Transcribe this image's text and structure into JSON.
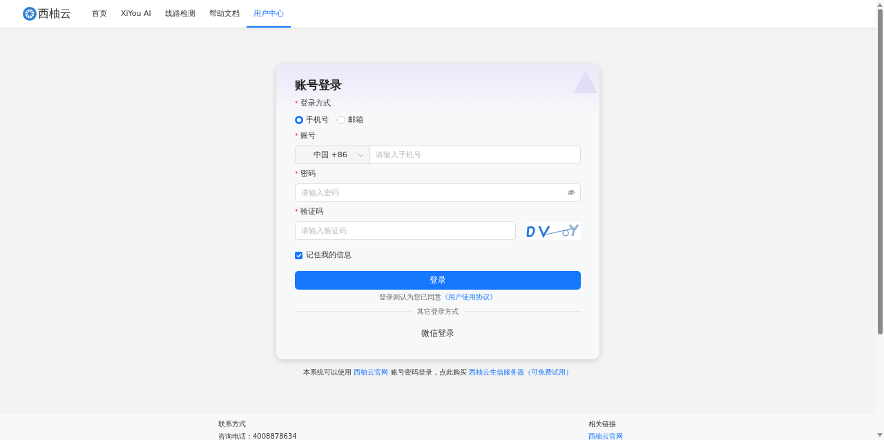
{
  "nav": {
    "brand": "西柚云",
    "items": [
      {
        "label": "首页",
        "selected": false
      },
      {
        "label": "XiYou AI",
        "selected": false
      },
      {
        "label": "线路检测",
        "selected": false
      },
      {
        "label": "帮助文档",
        "selected": false
      },
      {
        "label": "用户中心",
        "selected": true
      }
    ]
  },
  "login": {
    "title": "账号登录",
    "fields": [
      {
        "kind": "radio",
        "label": "登录方式",
        "marker": "*",
        "options": [
          {
            "label": "手机号",
            "selected": true
          },
          {
            "label": "邮箱",
            "selected": false
          }
        ]
      },
      {
        "kind": "phone",
        "label": "账号",
        "marker": "*",
        "country": "中国 +86",
        "placeholder": "请输入手机号"
      },
      {
        "kind": "password",
        "label": "密码",
        "marker": "*",
        "placeholder": "请输入密码"
      },
      {
        "kind": "captcha",
        "label": "验证码",
        "marker": "*",
        "placeholder": "请输入验证码"
      }
    ],
    "remember": {
      "label": "记住我的信息",
      "checked": true
    },
    "submit": "登录",
    "agreement": {
      "text": "登录则认为您已同意",
      "link": "《用户使用协议》"
    },
    "divider": "其它登录方式",
    "alt_login": "微信登录"
  },
  "notice": [
    {
      "kind": "text",
      "text": "本系统可以使用"
    },
    {
      "kind": "link",
      "text": "西柚云官网"
    },
    {
      "kind": "text",
      "text": "账号密码登录，点此购买"
    },
    {
      "kind": "link",
      "text": "西柚云生信服务器（可免费试用）"
    }
  ],
  "footer": {
    "columns": [
      {
        "title": "联系方式",
        "items": [
          {
            "kind": "text",
            "text": "咨询电话：4008878634"
          }
        ]
      },
      {
        "title": "相关链接",
        "items": [
          {
            "kind": "link",
            "text": "西柚云官网"
          }
        ]
      }
    ]
  }
}
